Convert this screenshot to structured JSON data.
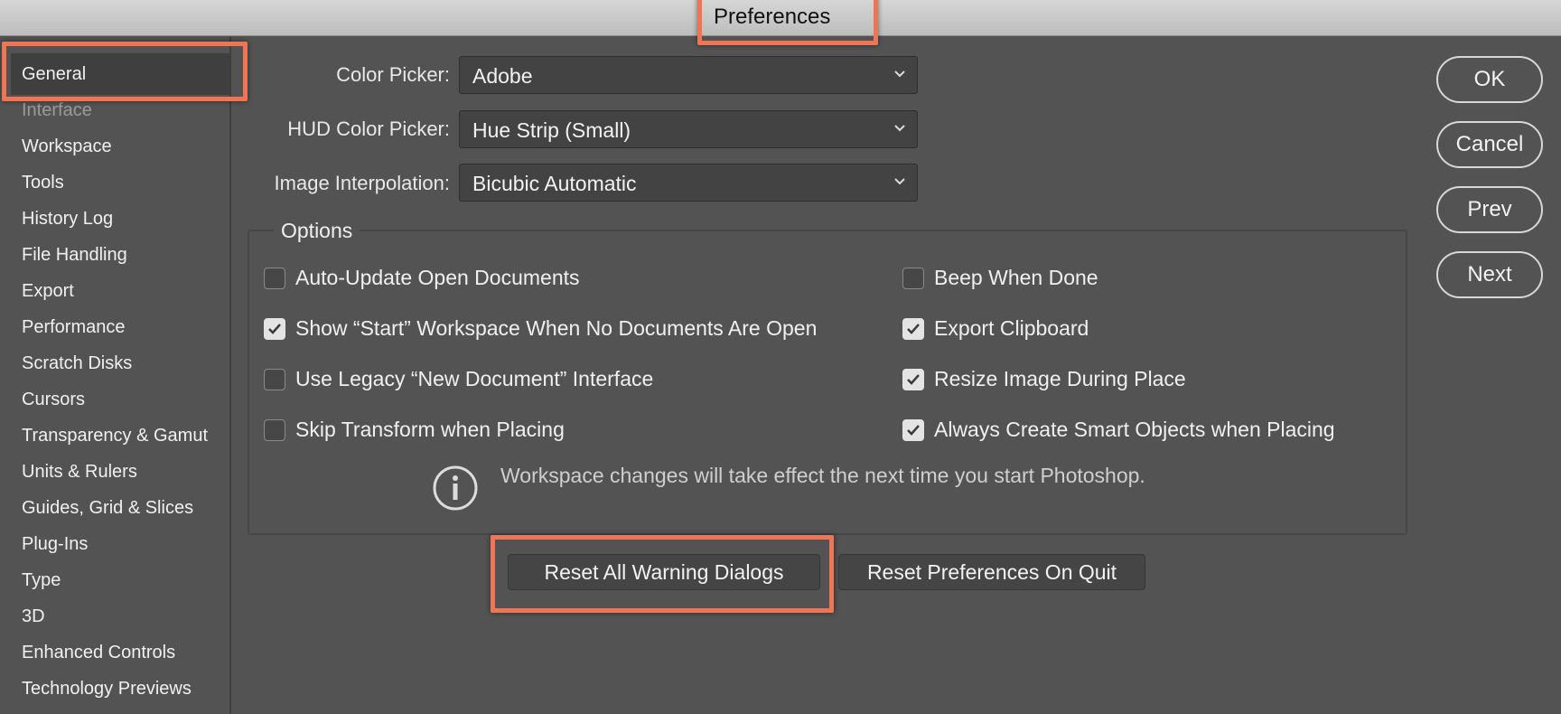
{
  "window": {
    "title": "Preferences"
  },
  "sidebar": {
    "items": [
      {
        "label": "General",
        "selected": true
      },
      {
        "label": "Interface"
      },
      {
        "label": "Workspace"
      },
      {
        "label": "Tools"
      },
      {
        "label": "History Log"
      },
      {
        "label": "File Handling"
      },
      {
        "label": "Export"
      },
      {
        "label": "Performance"
      },
      {
        "label": "Scratch Disks"
      },
      {
        "label": "Cursors"
      },
      {
        "label": "Transparency & Gamut"
      },
      {
        "label": "Units & Rulers"
      },
      {
        "label": "Guides, Grid & Slices"
      },
      {
        "label": "Plug-Ins"
      },
      {
        "label": "Type"
      },
      {
        "label": "3D"
      },
      {
        "label": "Enhanced Controls"
      },
      {
        "label": "Technology Previews"
      }
    ]
  },
  "fields": {
    "color_picker": {
      "label": "Color Picker:",
      "value": "Adobe"
    },
    "hud_color_picker": {
      "label": "HUD Color Picker:",
      "value": "Hue Strip (Small)"
    },
    "image_interpolation": {
      "label": "Image Interpolation:",
      "value": "Bicubic Automatic"
    }
  },
  "options": {
    "title": "Options",
    "left": [
      {
        "label": "Auto-Update Open Documents",
        "checked": false
      },
      {
        "label": "Show “Start” Workspace When No Documents Are Open",
        "checked": true
      },
      {
        "label": "Use Legacy “New Document” Interface",
        "checked": false
      },
      {
        "label": "Skip Transform when Placing",
        "checked": false
      }
    ],
    "right": [
      {
        "label": "Beep When Done",
        "checked": false
      },
      {
        "label": "Export Clipboard",
        "checked": true
      },
      {
        "label": "Resize Image During Place",
        "checked": true
      },
      {
        "label": "Always Create Smart Objects when Placing",
        "checked": true
      }
    ],
    "info": "Workspace changes will take effect the next time you start Photoshop."
  },
  "buttons": {
    "reset_warnings": "Reset All Warning Dialogs",
    "reset_prefs": "Reset Preferences On Quit",
    "ok": "OK",
    "cancel": "Cancel",
    "prev": "Prev",
    "next": "Next"
  },
  "colors": {
    "background": "#535353",
    "highlight": "#ee7555",
    "field": "#434343"
  },
  "icons": {
    "dropdown": "chevron-down-icon",
    "info": "info-icon",
    "check": "checkmark-icon"
  }
}
